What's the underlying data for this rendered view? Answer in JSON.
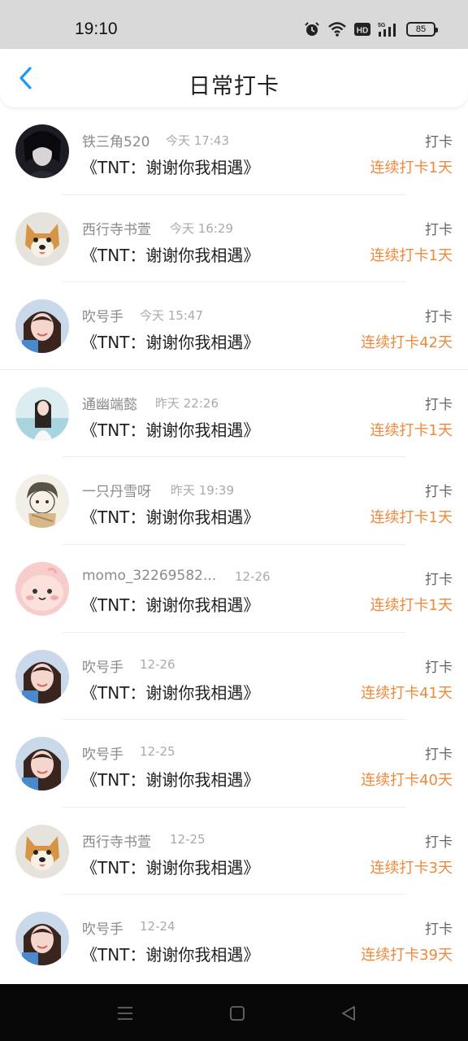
{
  "status_bar": {
    "time": "19:10",
    "icons": [
      "alarm-icon",
      "wifi-icon",
      "hd-icon",
      "signal-5g-icon"
    ],
    "battery": "85"
  },
  "header": {
    "title": "日常打卡",
    "back_icon": "chevron-left-icon",
    "accent_color": "#2196f3"
  },
  "colors": {
    "streak": "#f0883a"
  },
  "records": [
    {
      "user": "铁三角520",
      "time": "今天 17:43",
      "book": "《TNT：谢谢你我相遇》",
      "label": "打卡",
      "streak": "连续打卡1天"
    },
    {
      "user": "西行寺书萱",
      "time": "今天 16:29",
      "book": "《TNT：谢谢你我相遇》",
      "label": "打卡",
      "streak": "连续打卡1天"
    },
    {
      "user": "吹号手",
      "time": "今天 15:47",
      "book": "《TNT：谢谢你我相遇》",
      "label": "打卡",
      "streak": "连续打卡42天"
    },
    {
      "user": "通幽端懿",
      "time": "昨天 22:26",
      "book": "《TNT：谢谢你我相遇》",
      "label": "打卡",
      "streak": "连续打卡1天"
    },
    {
      "user": "一只丹雪呀",
      "time": "昨天 19:39",
      "book": "《TNT：谢谢你我相遇》",
      "label": "打卡",
      "streak": "连续打卡1天"
    },
    {
      "user": "momo_32269582...",
      "time": "12-26",
      "book": "《TNT：谢谢你我相遇》",
      "label": "打卡",
      "streak": "连续打卡1天"
    },
    {
      "user": "吹号手",
      "time": "12-26",
      "book": "《TNT：谢谢你我相遇》",
      "label": "打卡",
      "streak": "连续打卡41天"
    },
    {
      "user": "吹号手",
      "time": "12-25",
      "book": "《TNT：谢谢你我相遇》",
      "label": "打卡",
      "streak": "连续打卡40天"
    },
    {
      "user": "西行寺书萱",
      "time": "12-25",
      "book": "《TNT：谢谢你我相遇》",
      "label": "打卡",
      "streak": "连续打卡3天"
    },
    {
      "user": "吹号手",
      "time": "12-24",
      "book": "《TNT：谢谢你我相遇》",
      "label": "打卡",
      "streak": "连续打卡39天"
    }
  ],
  "nav_bar": {
    "buttons": [
      "menu-icon",
      "home-square-icon",
      "back-triangle-icon"
    ]
  }
}
